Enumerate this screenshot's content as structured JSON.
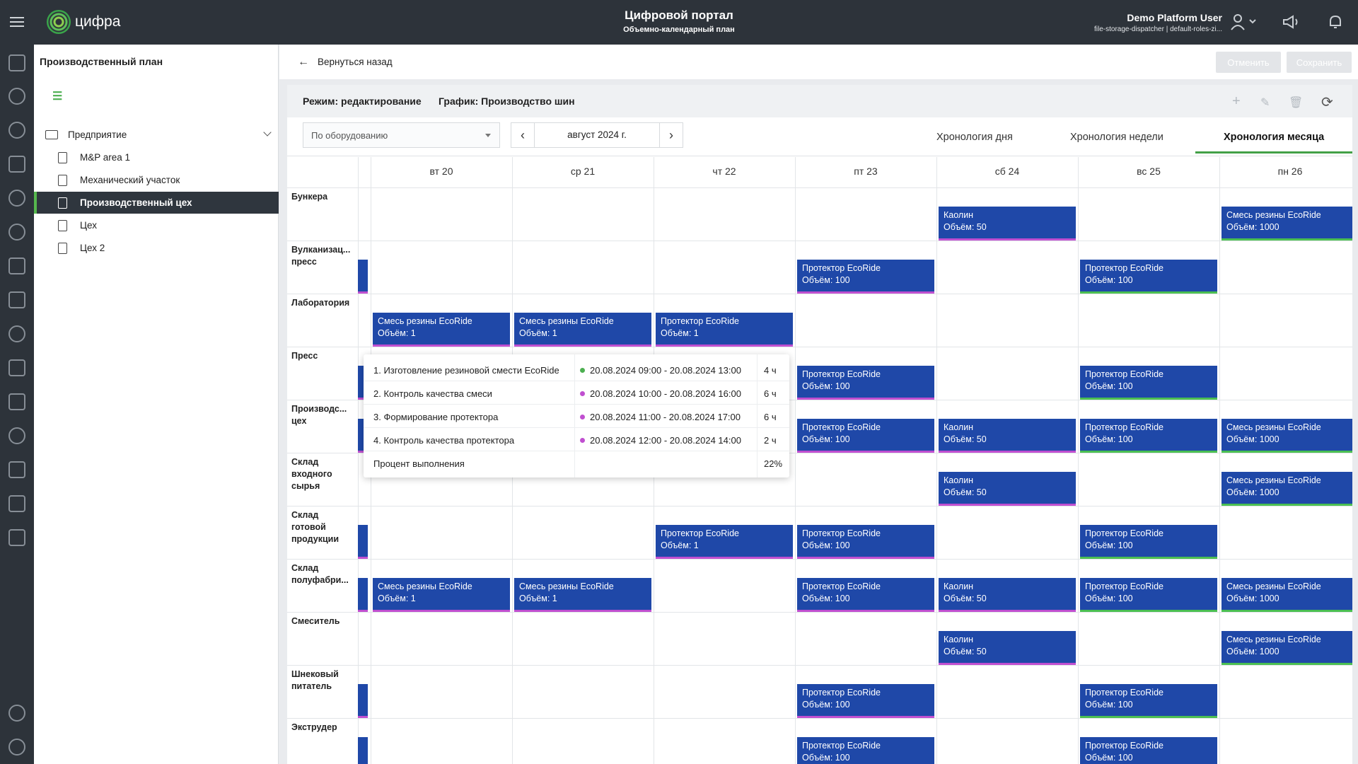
{
  "header": {
    "logo_text": "цифра",
    "portal_title": "Цифровой портал",
    "portal_subtitle": "Объемно-календарный план",
    "user_name": "Demo Platform User",
    "user_roles": "file-storage-dispatcher | default-roles-zi..."
  },
  "tree": {
    "title": "Производственный план",
    "root": "Предприятие",
    "items": [
      {
        "label": "M&P area 1"
      },
      {
        "label": "Механический участок"
      },
      {
        "label": "Производственный цех",
        "selected": true
      },
      {
        "label": "Цех"
      },
      {
        "label": "Цех 2"
      }
    ]
  },
  "toolbar": {
    "back_label": "Вернуться назад",
    "cancel_label": "Отменить",
    "save_label": "Сохранить"
  },
  "panel": {
    "mode_label": "Режим: редактирование",
    "graph_label": "График: Производство шин",
    "group_select": "По оборудованию",
    "date_label": "август 2024 г.",
    "tabs": [
      "Хронология дня",
      "Хронология недели",
      "Хронология месяца"
    ],
    "active_tab": "Хронология месяца"
  },
  "grid": {
    "days": [
      "вт 20",
      "ср 21",
      "чт 22",
      "пт 23",
      "сб 24",
      "вс 25",
      "пн 26"
    ],
    "rows": [
      {
        "label": "Бункера"
      },
      {
        "label": "Вулканизац... пресс"
      },
      {
        "label": "Лаборатория"
      },
      {
        "label": "Пресс"
      },
      {
        "label": "Производс... цех"
      },
      {
        "label": "Склад входного сырья"
      },
      {
        "label": "Склад готовой продукции"
      },
      {
        "label": "Склад полуфабри..."
      },
      {
        "label": "Смеситель"
      },
      {
        "label": "Шнековый питатель"
      },
      {
        "label": "Экструдер"
      }
    ],
    "events": [
      {
        "row": 0,
        "day": 4,
        "title": "Каолин",
        "volume": "Объём: 50",
        "bar": "p"
      },
      {
        "row": 0,
        "day": 6,
        "title": "Смесь резины EcoRide",
        "volume": "Объём: 1000",
        "bar": "g"
      },
      {
        "row": 1,
        "day": 3,
        "title": "Протектор EcoRide",
        "volume": "Объём: 100",
        "bar": "p"
      },
      {
        "row": 1,
        "day": 5,
        "title": "Протектор EcoRide",
        "volume": "Объём: 100",
        "bar": "g"
      },
      {
        "row": 2,
        "day": 0,
        "title": "Смесь резины EcoRide",
        "volume": "Объём: 1",
        "bar": "p"
      },
      {
        "row": 2,
        "day": 1,
        "title": "Смесь резины EcoRide",
        "volume": "Объём: 1",
        "bar": "p"
      },
      {
        "row": 2,
        "day": 2,
        "title": "Протектор EcoRide",
        "volume": "Объём: 1",
        "bar": "p"
      },
      {
        "row": 3,
        "day": 3,
        "title": "Протектор EcoRide",
        "volume": "Объём: 100",
        "bar": "p"
      },
      {
        "row": 3,
        "day": 5,
        "title": "Протектор EcoRide",
        "volume": "Объём: 100",
        "bar": "g"
      },
      {
        "row": 4,
        "day": 3,
        "title": "Протектор EcoRide",
        "volume": "Объём: 100",
        "bar": "p"
      },
      {
        "row": 4,
        "day": 4,
        "title": "Каолин",
        "volume": "Объём: 50",
        "bar": "p"
      },
      {
        "row": 4,
        "day": 5,
        "title": "Протектор EcoRide",
        "volume": "Объём: 100",
        "bar": "g"
      },
      {
        "row": 4,
        "day": 6,
        "title": "Смесь резины EcoRide",
        "volume": "Объём: 1000",
        "bar": "g"
      },
      {
        "row": 5,
        "day": 4,
        "title": "Каолин",
        "volume": "Объём: 50",
        "bar": "p"
      },
      {
        "row": 5,
        "day": 6,
        "title": "Смесь резины EcoRide",
        "volume": "Объём: 1000",
        "bar": "g"
      },
      {
        "row": 6,
        "day": 2,
        "title": "Протектор EcoRide",
        "volume": "Объём: 1",
        "bar": "p"
      },
      {
        "row": 6,
        "day": 3,
        "title": "Протектор EcoRide",
        "volume": "Объём: 100",
        "bar": "p"
      },
      {
        "row": 6,
        "day": 5,
        "title": "Протектор EcoRide",
        "volume": "Объём: 100",
        "bar": "g"
      },
      {
        "row": 7,
        "day": 0,
        "title": "Смесь резины EcoRide",
        "volume": "Объём: 1",
        "bar": "p"
      },
      {
        "row": 7,
        "day": 1,
        "title": "Смесь резины EcoRide",
        "volume": "Объём: 1",
        "bar": "p"
      },
      {
        "row": 7,
        "day": 3,
        "title": "Протектор EcoRide",
        "volume": "Объём: 100",
        "bar": "p"
      },
      {
        "row": 7,
        "day": 4,
        "title": "Каолин",
        "volume": "Объём: 50",
        "bar": "p"
      },
      {
        "row": 7,
        "day": 5,
        "title": "Протектор EcoRide",
        "volume": "Объём: 100",
        "bar": "g"
      },
      {
        "row": 7,
        "day": 6,
        "title": "Смесь резины EcoRide",
        "volume": "Объём: 1000",
        "bar": "g"
      },
      {
        "row": 8,
        "day": 4,
        "title": "Каолин",
        "volume": "Объём: 50",
        "bar": "p"
      },
      {
        "row": 8,
        "day": 6,
        "title": "Смесь резины EcoRide",
        "volume": "Объём: 1000",
        "bar": "g"
      },
      {
        "row": 9,
        "day": 3,
        "title": "Протектор EcoRide",
        "volume": "Объём: 100",
        "bar": "p"
      },
      {
        "row": 9,
        "day": 5,
        "title": "Протектор EcoRide",
        "volume": "Объём: 100",
        "bar": "g"
      },
      {
        "row": 10,
        "day": 3,
        "title": "Протектор EcoRide",
        "volume": "Объём: 100",
        "bar": "p"
      },
      {
        "row": 10,
        "day": 5,
        "title": "Протектор EcoRide",
        "volume": "Объём: 100",
        "bar": "g"
      }
    ],
    "stub_rows": [
      1,
      3,
      4,
      6,
      7,
      9,
      10
    ]
  },
  "tooltip": {
    "rows": [
      {
        "name": "1. Изготовление резиновой смести EcoRide",
        "dot": "#4caf50",
        "period": "20.08.2024 09:00 - 20.08.2024 13:00",
        "duration": "4 ч"
      },
      {
        "name": "2. Контроль качества смеси",
        "dot": "#c04fd0",
        "period": "20.08.2024 10:00 - 20.08.2024 16:00",
        "duration": "6 ч"
      },
      {
        "name": "3. Формирование протектора",
        "dot": "#c04fd0",
        "period": "20.08.2024 11:00 - 20.08.2024 17:00",
        "duration": "6 ч"
      },
      {
        "name": "4. Контроль качества протектора",
        "dot": "#c04fd0",
        "period": "20.08.2024 12:00 - 20.08.2024 14:00",
        "duration": "2 ч"
      }
    ],
    "progress_label": "Процент выполнения",
    "progress_value": "22%"
  },
  "colors": {
    "event_bg": "#1f48a8",
    "bar_purple": "#c04fd0",
    "bar_green": "#4bbf52",
    "accent": "#43a047"
  }
}
